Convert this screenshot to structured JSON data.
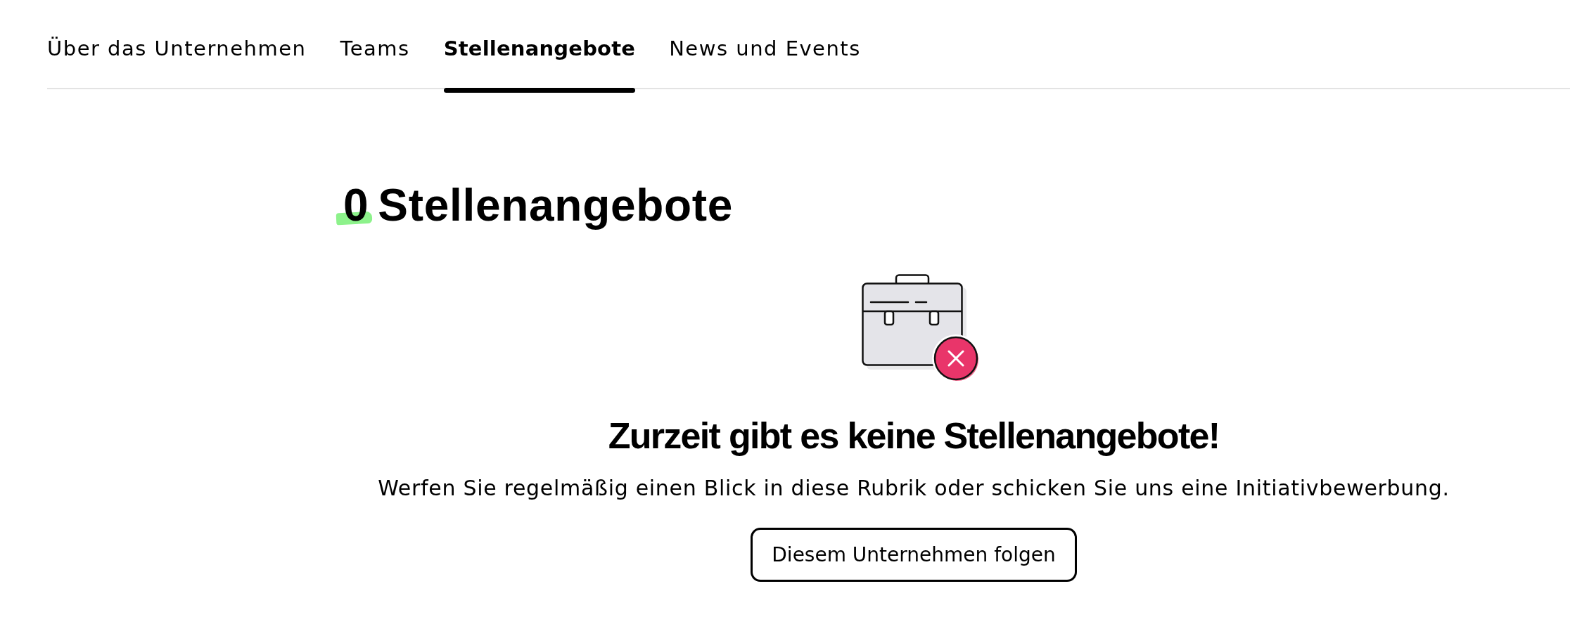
{
  "tabs": [
    {
      "label": "Über das Unternehmen",
      "selected": false
    },
    {
      "label": "Teams",
      "selected": false
    },
    {
      "label": "Stellenangebote",
      "selected": true
    },
    {
      "label": "News und Events",
      "selected": false
    }
  ],
  "heading": {
    "count": "0",
    "label": "Stellenangebote"
  },
  "empty_state": {
    "title": "Zurzeit gibt es keine Stellenangebote!",
    "message": "Werfen Sie regelmäßig einen Blick in diese Rubrik oder schicken Sie uns eine Initiativbewerbung.",
    "button": "Diesem Unternehmen folgen"
  }
}
